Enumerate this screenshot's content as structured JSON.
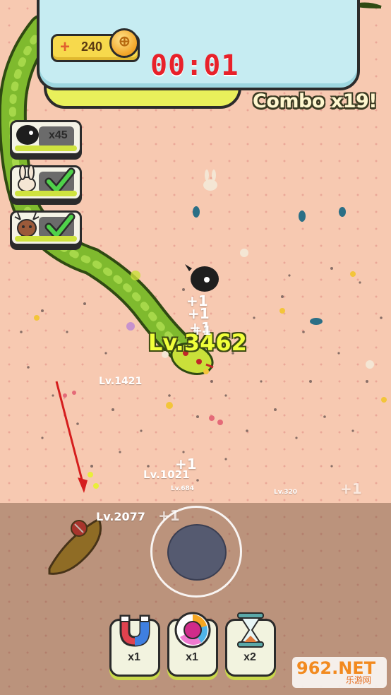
{
  "hud": {
    "coins": "240",
    "coin_plus": "+",
    "coin_symbol": "⊕",
    "timer": "00:01",
    "combo": "Combo x19!"
  },
  "quests": [
    {
      "animal": "crow-icon",
      "count": "x45",
      "done": false
    },
    {
      "animal": "rabbit-icon",
      "done": true
    },
    {
      "animal": "deer-icon",
      "done": true
    }
  ],
  "player": {
    "level_label": "Lv.3462"
  },
  "enemies": [
    {
      "level_label": "Lv.1421"
    },
    {
      "level_label": "Lv.1021"
    },
    {
      "level_label": "Lv.684"
    },
    {
      "level_label": "Lv.320"
    },
    {
      "level_label": "Lv.2077"
    }
  ],
  "floating_texts": [
    "+1",
    "+1",
    "+1",
    "+1",
    "+1",
    "+1",
    "+1"
  ],
  "powerups": [
    {
      "name": "magnet",
      "count": "x1"
    },
    {
      "name": "compass",
      "count": "x1"
    },
    {
      "name": "hourglass",
      "count": "x2"
    }
  ],
  "watermark": {
    "main": "962.NET",
    "sub": "乐游网"
  },
  "colors": {
    "ground": "#f7c9b1",
    "snake": "#7fba2e",
    "timer": "#e8212a",
    "level": "#f0ff3a",
    "hud": "#c6ecf2"
  }
}
